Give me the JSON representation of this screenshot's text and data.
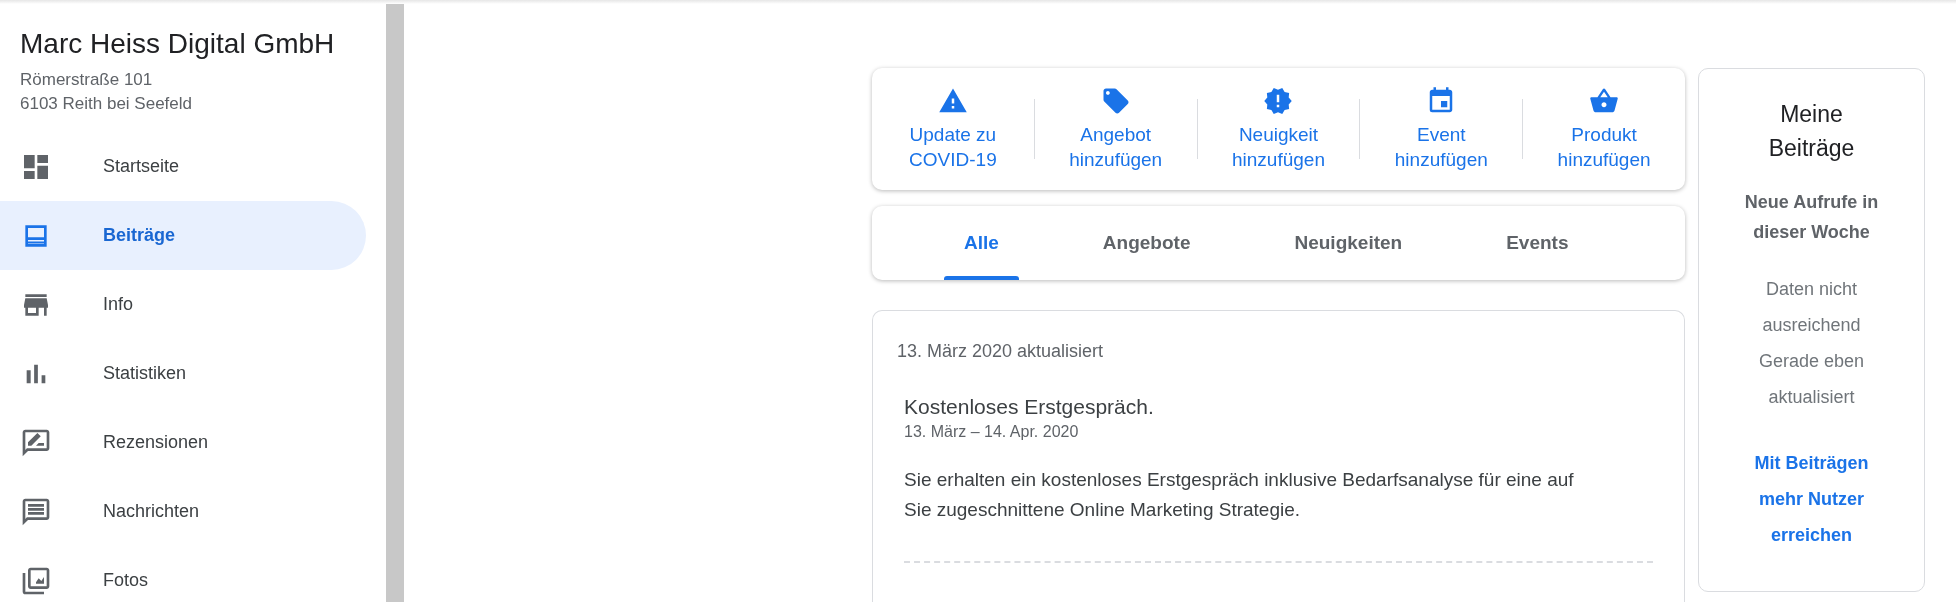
{
  "business": {
    "name": "Marc Heiss Digital GmbH",
    "address_lines": [
      "Römerstraße 101",
      "6103 Reith bei Seefeld"
    ]
  },
  "sidebar": {
    "items": [
      {
        "label": "Startseite",
        "selected": false
      },
      {
        "label": "Beiträge",
        "selected": true
      },
      {
        "label": "Info",
        "selected": false
      },
      {
        "label": "Statistiken",
        "selected": false
      },
      {
        "label": "Rezensionen",
        "selected": false
      },
      {
        "label": "Nachrichten",
        "selected": false
      },
      {
        "label": "Fotos",
        "selected": false
      }
    ]
  },
  "actions": [
    {
      "kind": "covid",
      "label": [
        "Update zu",
        "COVID-19"
      ]
    },
    {
      "kind": "offer",
      "label": [
        "Angebot",
        "hinzufügen"
      ]
    },
    {
      "kind": "news",
      "label": [
        "Neuigkeit",
        "hinzufügen"
      ]
    },
    {
      "kind": "event",
      "label": [
        "Event",
        "hinzufügen"
      ]
    },
    {
      "kind": "product",
      "label": [
        "Produkt",
        "hinzufügen"
      ]
    }
  ],
  "tabs": [
    {
      "label": "Alle",
      "selected": true
    },
    {
      "label": "Angebote",
      "selected": false
    },
    {
      "label": "Neuigkeiten",
      "selected": false
    },
    {
      "label": "Events",
      "selected": false
    }
  ],
  "post": {
    "updated": "13. März 2020 aktualisiert",
    "title": "Kostenloses Erstgespräch.",
    "dates": "13. März – 14. Apr. 2020",
    "body": "Sie erhalten ein kostenloses Erstgespräch inklusive Bedarfsanalyse für eine auf Sie zugeschnittene Online Marketing Strategie."
  },
  "stats_panel": {
    "title": "Meine Beiträge",
    "subtitle": "Neue Aufrufe in dieser Woche",
    "lines": [
      "Daten nicht ausreichend",
      "Gerade eben aktualisiert"
    ],
    "link": "Mit Beiträgen mehr Nutzer erreichen"
  }
}
